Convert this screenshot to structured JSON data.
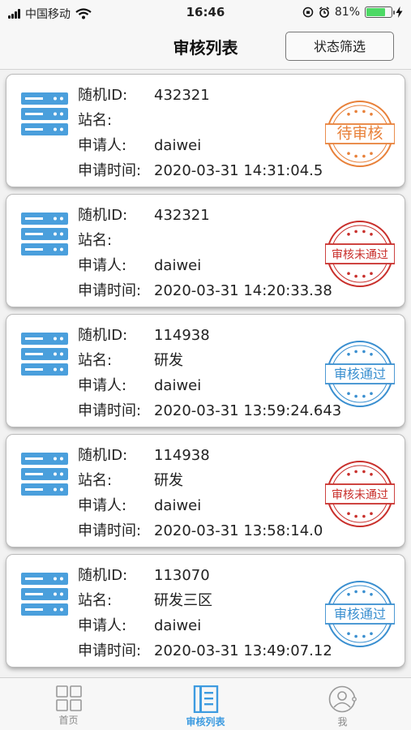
{
  "status_bar": {
    "carrier": "中国移动",
    "time": "16:46",
    "battery": "81%",
    "battery_level": 0.81
  },
  "nav": {
    "title": "审核列表",
    "filter_label": "状态筛选"
  },
  "labels": {
    "random_id": "随机ID:",
    "station": "站名:",
    "applicant": "申请人:",
    "time": "申请时间:"
  },
  "records": [
    {
      "random_id": "432321",
      "station": "",
      "applicant": "daiwei",
      "time": "2020-03-31 14:31:04.5",
      "status": "待审核",
      "status_color": "#e8813a"
    },
    {
      "random_id": "432321",
      "station": "",
      "applicant": "daiwei",
      "time": "2020-03-31 14:20:33.38",
      "status": "审核未通过",
      "status_color": "#c9302c"
    },
    {
      "random_id": "114938",
      "station": "研发",
      "applicant": "daiwei",
      "time": "2020-03-31 13:59:24.643",
      "status": "审核通过",
      "status_color": "#3a8fd0"
    },
    {
      "random_id": "114938",
      "station": "研发",
      "applicant": "daiwei",
      "time": "2020-03-31 13:58:14.0",
      "status": "审核未通过",
      "status_color": "#c9302c"
    },
    {
      "random_id": "113070",
      "station": "研发三区",
      "applicant": "daiwei",
      "time": "2020-03-31 13:49:07.12",
      "status": "审核通过",
      "status_color": "#3a8fd0"
    }
  ],
  "tabs": [
    {
      "label": "首页",
      "icon": "grid-icon",
      "active": false
    },
    {
      "label": "审核列表",
      "icon": "document-list-icon",
      "active": true
    },
    {
      "label": "我",
      "icon": "user-profile-icon",
      "active": false
    }
  ],
  "colors": {
    "accent": "#3d9be0",
    "server_icon": "#4a9fdc",
    "inactive_tab": "#888888"
  }
}
